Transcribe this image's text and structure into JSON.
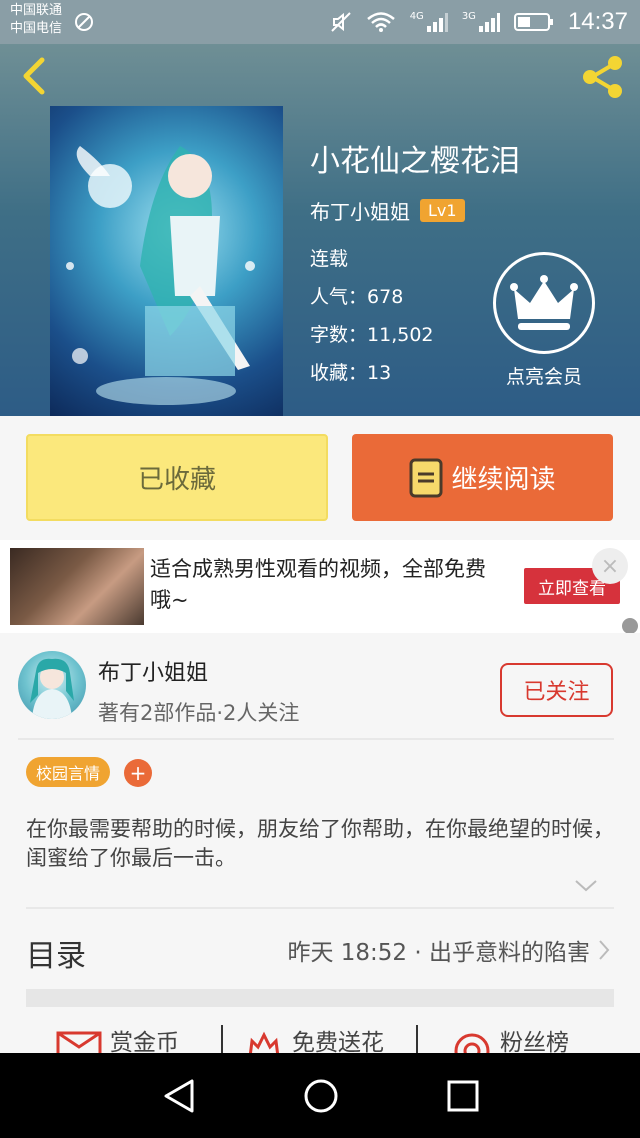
{
  "status_bar": {
    "carrier_1": "中国联通",
    "carrier_2": "中国电信",
    "time": "14:37",
    "net_1": "4G",
    "net_2": "3G"
  },
  "book": {
    "title": "小花仙之樱花泪",
    "author": "布丁小姐姐",
    "level": "Lv1",
    "status": "连载",
    "popularity_label": "人气：",
    "popularity": "678",
    "word_count_label": "字数：",
    "word_count": "11,502",
    "favorites_label": "收藏：",
    "favorites": "13",
    "vip_label": "点亮会员"
  },
  "actions": {
    "collected": "已收藏",
    "continue_reading": "继续阅读"
  },
  "ad": {
    "text": "适合成熟男性观看的视频，全部免费哦~",
    "cta": "立即查看",
    "close": "×"
  },
  "author_section": {
    "name": "布丁小姐姐",
    "stats": "著有2部作品·2人关注",
    "follow": "已关注"
  },
  "tags": {
    "items": [
      "校园言情"
    ],
    "add": "+"
  },
  "description": "在你最需要帮助的时候，朋友给了你帮助，在你最绝望的时候，闺蜜给了你最后一击。",
  "toc": {
    "label": "目录",
    "latest": "昨天 18:52 · 出乎意料的陷害"
  },
  "bottom_tabs": [
    "赏金币",
    "免费送花",
    "粉丝榜"
  ],
  "colors": {
    "accent_orange": "#ea6a38",
    "collected_yellow": "#fbe87c",
    "badge_gold": "#f0a431",
    "follow_red": "#d8392f"
  }
}
